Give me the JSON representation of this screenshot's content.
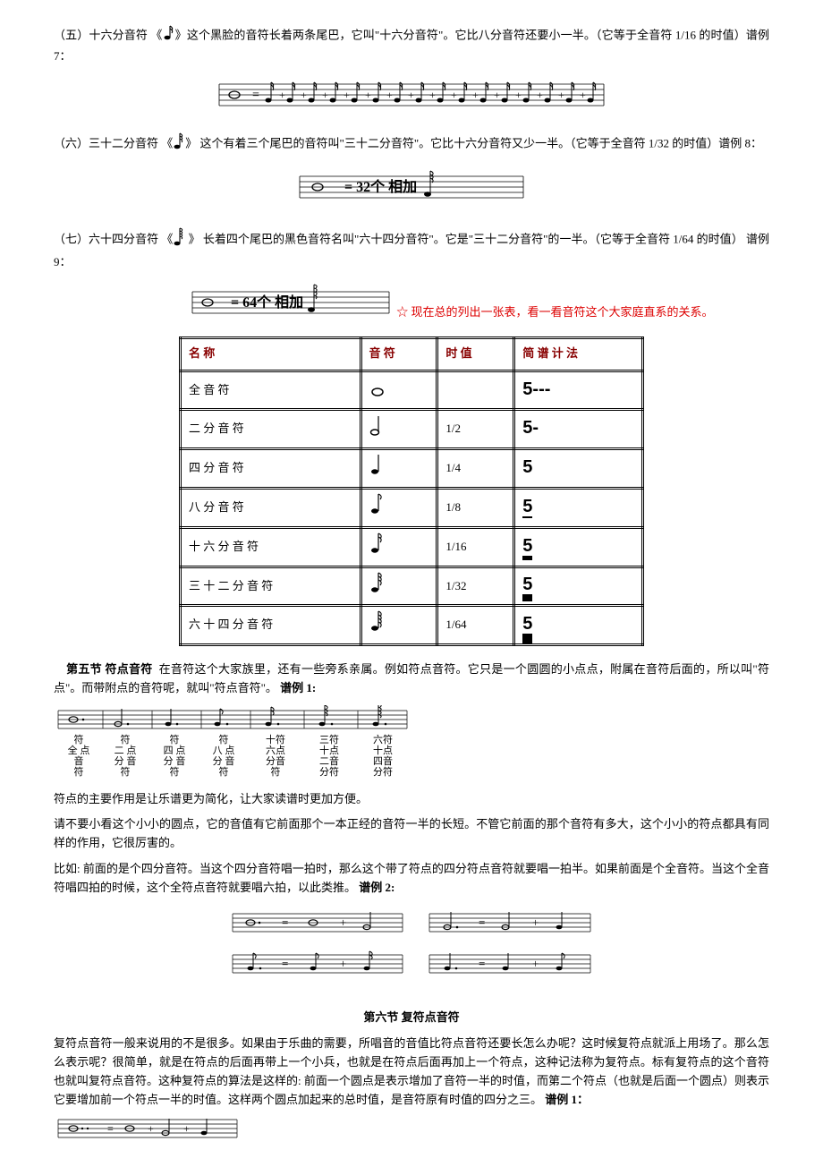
{
  "section5": {
    "title": "（五）十六分音符",
    "desc": "这个黑脸的音符长着两条尾巴，它叫\"十六分音符\"。它比八分音符还要小一半。（它等于全音符 1/16 的时值）谱例 7："
  },
  "section6": {
    "title": "（六）三十二分音符",
    "desc": "这个有着三个尾巴的音符叫\"三十二分音符\"。它比十六分音符又少一半。（它等于全音符 1/32 的时值）谱例 8：",
    "staff_text": "= 32个    相加"
  },
  "section7": {
    "title": "（七）六十四分音符",
    "desc": "长着四个尾巴的黑色音符名叫\"六十四分音符\"。它是\"三十二分音符\"的一半。（它等于全音符 1/64 的时值）  谱例 9：",
    "staff_text": "= 64个    相加"
  },
  "summary_line": "☆ 现在总的列出一张表，看一看音符这个大家庭直系的关系。",
  "table": {
    "headers": [
      "名 称",
      "音 符",
      "时 值",
      "简 谱 计 法"
    ],
    "rows": [
      {
        "name": "全 音 符",
        "duration": "",
        "jianpu": "5---",
        "flags": 0
      },
      {
        "name": "二 分 音 符",
        "duration": "1/2",
        "jianpu": "5-",
        "flags": 0
      },
      {
        "name": "四 分 音 符",
        "duration": "1/4",
        "jianpu": "5",
        "flags": 0
      },
      {
        "name": "八 分 音 符",
        "duration": "1/8",
        "jianpu": "5",
        "flags": 1
      },
      {
        "name": "十 六 分 音 符",
        "duration": "1/16",
        "jianpu": "5",
        "flags": 2
      },
      {
        "name": "三 十 二 分 音 符",
        "duration": "1/32",
        "jianpu": "5",
        "flags": 3
      },
      {
        "name": "六 十 四 分 音 符",
        "duration": "1/64",
        "jianpu": "5",
        "flags": 4
      }
    ]
  },
  "section_dot": {
    "heading": "第五节 符点音符",
    "text1": "在音符这个大家族里，还有一些旁系亲属。例如符点音符。它只是一个圆圆的小点点，附属在音符后面的，所以叫\"符点\"。而带附点的音符呢，就叫\"符点音符\"。",
    "label_ex1": "谱例 1:",
    "labels": [
      "符点全音符",
      "符点二分音符",
      "符点四分音符",
      "符点八分音符",
      "十符六点分音符",
      "三符十点二音分符",
      "六符十点四音分符"
    ]
  },
  "dot_para1": "符点的主要作用是让乐谱更为简化，让大家读谱时更加方便。",
  "dot_para2": "请不要小看这个小小的圆点，它的音值有它前面那个一本正经的音符一半的长短。不管它前面的那个音符有多大，这个小小的符点都具有同样的作用，它很厉害的。",
  "dot_para3": "比如: 前面的是个四分音符。当这个四分音符唱一拍时，那么这个带了符点的四分符点音符就要唱一拍半。如果前面是个全音符。当这个全音符唱四拍的时候，这个全符点音符就要唱六拍，以此类推。",
  "label_ex2": "谱例 2:",
  "section_double": {
    "heading": "第六节 复符点音符",
    "text": "复符点音符一般来说用的不是很多。如果由于乐曲的需要，所唱音的音值比符点音符还要长怎么办呢？这时候复符点就派上用场了。那么怎么表示呢？很简单，就是在符点的后面再带上一个小兵，也就是在符点后面再加上一个符点，这种记法称为复符点。标有复符点的这个音符也就叫复符点音符。这种复符点的算法是这样的: 前面一个圆点是表示增加了音符一半的时值，而第二个符点（也就是后面一个圆点）则表示它要增加前一个符点一半的时值。这样两个圆点加起来的总时值，是音符原有时值的四分之三。",
    "label_ex1": "谱例 1："
  }
}
